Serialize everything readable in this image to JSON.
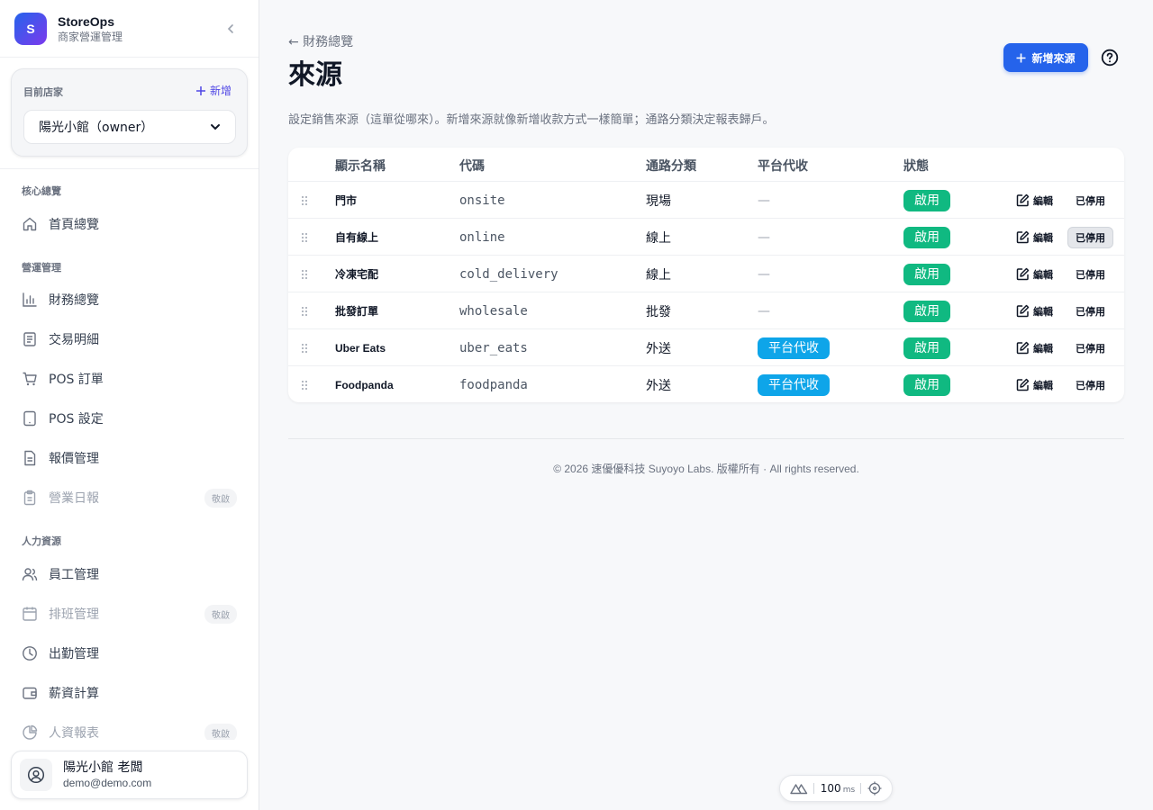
{
  "brand": {
    "name": "StoreOps",
    "subtitle": "商家營運管理",
    "logo_letter": "S"
  },
  "store": {
    "label": "目前店家",
    "add_label": "新增",
    "selected": "陽光小館（owner）"
  },
  "nav": {
    "sections": [
      {
        "title": "核心總覽",
        "items": [
          {
            "label": "首頁總覽",
            "icon": "home-icon"
          }
        ]
      },
      {
        "title": "營運管理",
        "items": [
          {
            "label": "財務總覽",
            "icon": "bar-chart-icon"
          },
          {
            "label": "交易明細",
            "icon": "receipt-icon"
          },
          {
            "label": "POS 訂單",
            "icon": "cart-icon"
          },
          {
            "label": "POS 設定",
            "icon": "tablet-icon"
          },
          {
            "label": "報價管理",
            "icon": "document-icon"
          },
          {
            "label": "營業日報",
            "icon": "clipboard-icon",
            "badge": "敬啟",
            "disabled": true
          }
        ]
      },
      {
        "title": "人力資源",
        "items": [
          {
            "label": "員工管理",
            "icon": "users-icon"
          },
          {
            "label": "排班管理",
            "icon": "calendar-icon",
            "badge": "敬啟",
            "disabled": true
          },
          {
            "label": "出勤管理",
            "icon": "clock-icon"
          },
          {
            "label": "薪資計算",
            "icon": "wallet-icon"
          },
          {
            "label": "人資報表",
            "icon": "pie-chart-icon",
            "badge": "敬啟",
            "disabled": true
          }
        ]
      }
    ]
  },
  "user": {
    "name": "陽光小館 老闆",
    "email": "demo@demo.com"
  },
  "page": {
    "breadcrumb": "← 財務總覽",
    "title": "來源",
    "primary_button": "新增來源",
    "description": "設定銷售來源（這單從哪來）。新增來源就像新增收款方式一樣簡單；通路分類決定報表歸戶。"
  },
  "table": {
    "headers": {
      "name": "顯示名稱",
      "code": "代碼",
      "channel": "通路分類",
      "platform": "平台代收",
      "status": "狀態"
    },
    "edit_label": "編輯",
    "disable_label": "已停用",
    "rows": [
      {
        "name": "門市",
        "code": "onsite",
        "channel": "現場",
        "platform": "—",
        "status": "啟用"
      },
      {
        "name": "自有線上",
        "code": "online",
        "channel": "線上",
        "platform": "—",
        "status": "啟用"
      },
      {
        "name": "冷凍宅配",
        "code": "cold_delivery",
        "channel": "線上",
        "platform": "—",
        "status": "啟用"
      },
      {
        "name": "批發訂單",
        "code": "wholesale",
        "channel": "批發",
        "platform": "—",
        "status": "啟用"
      },
      {
        "name": "Uber Eats",
        "code": "uber_eats",
        "channel": "外送",
        "platform": "平台代收",
        "status": "啟用"
      },
      {
        "name": "Foodpanda",
        "code": "foodpanda",
        "channel": "外送",
        "platform": "平台代收",
        "status": "啟用"
      }
    ]
  },
  "footer": "© 2026 速優優科技 Suyoyo Labs. 版權所有 · All rights reserved.",
  "devbar": {
    "value": "100",
    "unit": "ms"
  },
  "colors": {
    "primary": "#2563eb",
    "success": "#10b981",
    "info": "#0ea5e9"
  }
}
